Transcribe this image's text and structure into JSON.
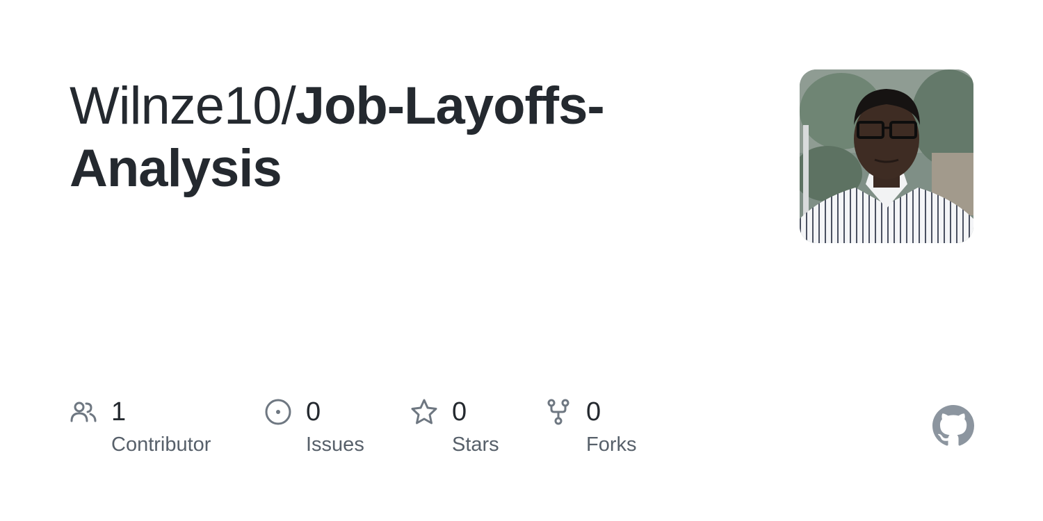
{
  "repo": {
    "owner": "Wilnze10/",
    "name": "Job-Layoffs-Analysis"
  },
  "avatar": {
    "icon": "user-avatar-photo"
  },
  "stats": [
    {
      "icon": "people-icon",
      "value": "1",
      "label": "Contributor"
    },
    {
      "icon": "issue-icon",
      "value": "0",
      "label": "Issues"
    },
    {
      "icon": "star-icon",
      "value": "0",
      "label": "Stars"
    },
    {
      "icon": "fork-icon",
      "value": "0",
      "label": "Forks"
    }
  ],
  "brand": {
    "icon": "github-logo-icon",
    "text_color": "#24292f",
    "muted_color": "#57606a",
    "icon_color": "#6e7781",
    "logo_color": "#8c959f"
  }
}
